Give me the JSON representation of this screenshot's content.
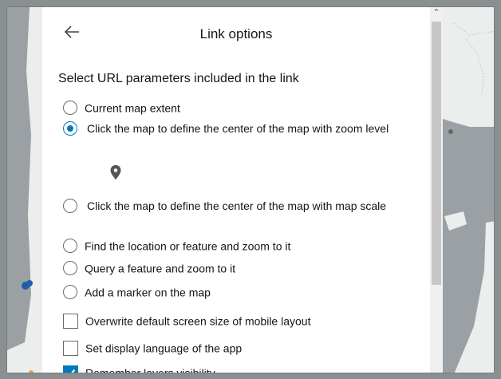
{
  "panel": {
    "title": "Link options",
    "section_label": "Select URL parameters included in the link",
    "radio_options": [
      {
        "label": "Current map extent",
        "checked": false
      },
      {
        "label": "Click the map to define the center of the map with zoom level",
        "checked": true
      },
      {
        "label": "Click the map to define the center of the map with map scale",
        "checked": false
      },
      {
        "label": "Find the location or feature and zoom to it",
        "checked": false
      },
      {
        "label": "Query a feature and zoom to it",
        "checked": false
      },
      {
        "label": "Add a marker on the map",
        "checked": false
      }
    ],
    "checkbox_options": [
      {
        "label": "Overwrite default screen size of mobile layout",
        "checked": false
      },
      {
        "label": "Set display language of the app",
        "checked": false
      },
      {
        "label": "Remember layers visibility",
        "checked": true
      }
    ]
  },
  "icons": {
    "back": "arrow-left-icon",
    "pin": "map-pin-icon",
    "scroll_up": "chevron-up-icon"
  },
  "colors": {
    "accent": "#0079c1",
    "panel_bg": "#ffffff",
    "map_water": "#9aa0a4",
    "map_land": "#eceeed"
  }
}
